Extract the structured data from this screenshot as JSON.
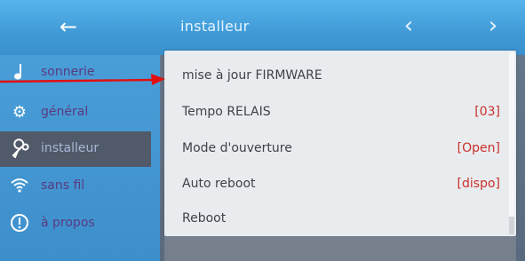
{
  "header": {
    "back_icon": "arrow-left-icon",
    "title": "installeur",
    "prev_icon": "chevron-left-icon",
    "next_icon": "chevron-right-icon"
  },
  "sidebar": {
    "items": [
      {
        "label": "sonnerie",
        "icon": "music-note-icon",
        "active": false
      },
      {
        "label": "général",
        "icon": "gear-icon",
        "active": false
      },
      {
        "label": "installeur",
        "icon": "wrench-icon",
        "active": true
      },
      {
        "label": "sans fil",
        "icon": "wifi-icon",
        "active": false
      },
      {
        "label": "à propos",
        "icon": "info-icon",
        "active": false
      }
    ]
  },
  "settings": {
    "rows": [
      {
        "label": "mise à jour FIRMWARE",
        "value": ""
      },
      {
        "label": "Tempo RELAIS",
        "value": "[03]"
      },
      {
        "label": "Mode d'ouverture",
        "value": "[Open]"
      },
      {
        "label": "Auto reboot",
        "value": "[dispo]"
      },
      {
        "label": "Reboot",
        "value": ""
      }
    ]
  },
  "colors": {
    "accent_blue": "#3f9ad6",
    "value_red": "#c8302a",
    "annotation_red": "#e01010"
  }
}
